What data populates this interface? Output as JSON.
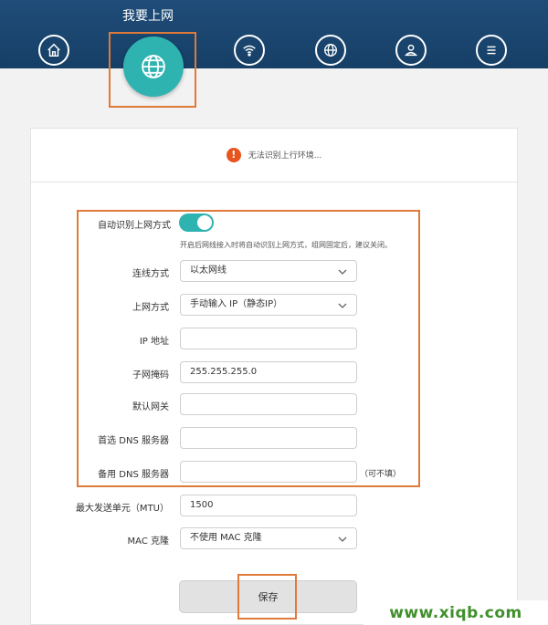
{
  "header": {
    "active_tab_title": "我要上网",
    "nav_icons": [
      "home-icon",
      "globe-icon",
      "wifi-icon",
      "globe-settings-icon",
      "user-icon",
      "menu-icon"
    ]
  },
  "status": {
    "message": "无法识别上行环境..."
  },
  "form": {
    "auto_detect_label": "自动识别上网方式",
    "auto_detect_on": true,
    "auto_detect_hint": "开启后网线接入时将自动识别上网方式，组网固定后，建议关闭。",
    "connection_type_label": "连线方式",
    "connection_type_value": "以太网线",
    "internet_mode_label": "上网方式",
    "internet_mode_value": "手动输入 IP（静态IP）",
    "ip_label": "IP 地址",
    "ip_value": "",
    "mask_label": "子网掩码",
    "mask_value": "255.255.255.0",
    "gateway_label": "默认网关",
    "gateway_value": "",
    "dns1_label": "首选 DNS 服务器",
    "dns1_value": "",
    "dns2_label": "备用 DNS 服务器",
    "dns2_value": "",
    "dns2_note": "（可不填）",
    "mtu_label": "最大发送单元（MTU）",
    "mtu_value": "1500",
    "mac_clone_label": "MAC 克隆",
    "mac_clone_value": "不使用 MAC 克隆",
    "save_label": "保存"
  },
  "watermark": "www.xiqb.com",
  "colors": {
    "accent": "#2fb3b1",
    "header": "#1f4d79",
    "highlight": "#e07a3a",
    "warning": "#e8541e"
  }
}
